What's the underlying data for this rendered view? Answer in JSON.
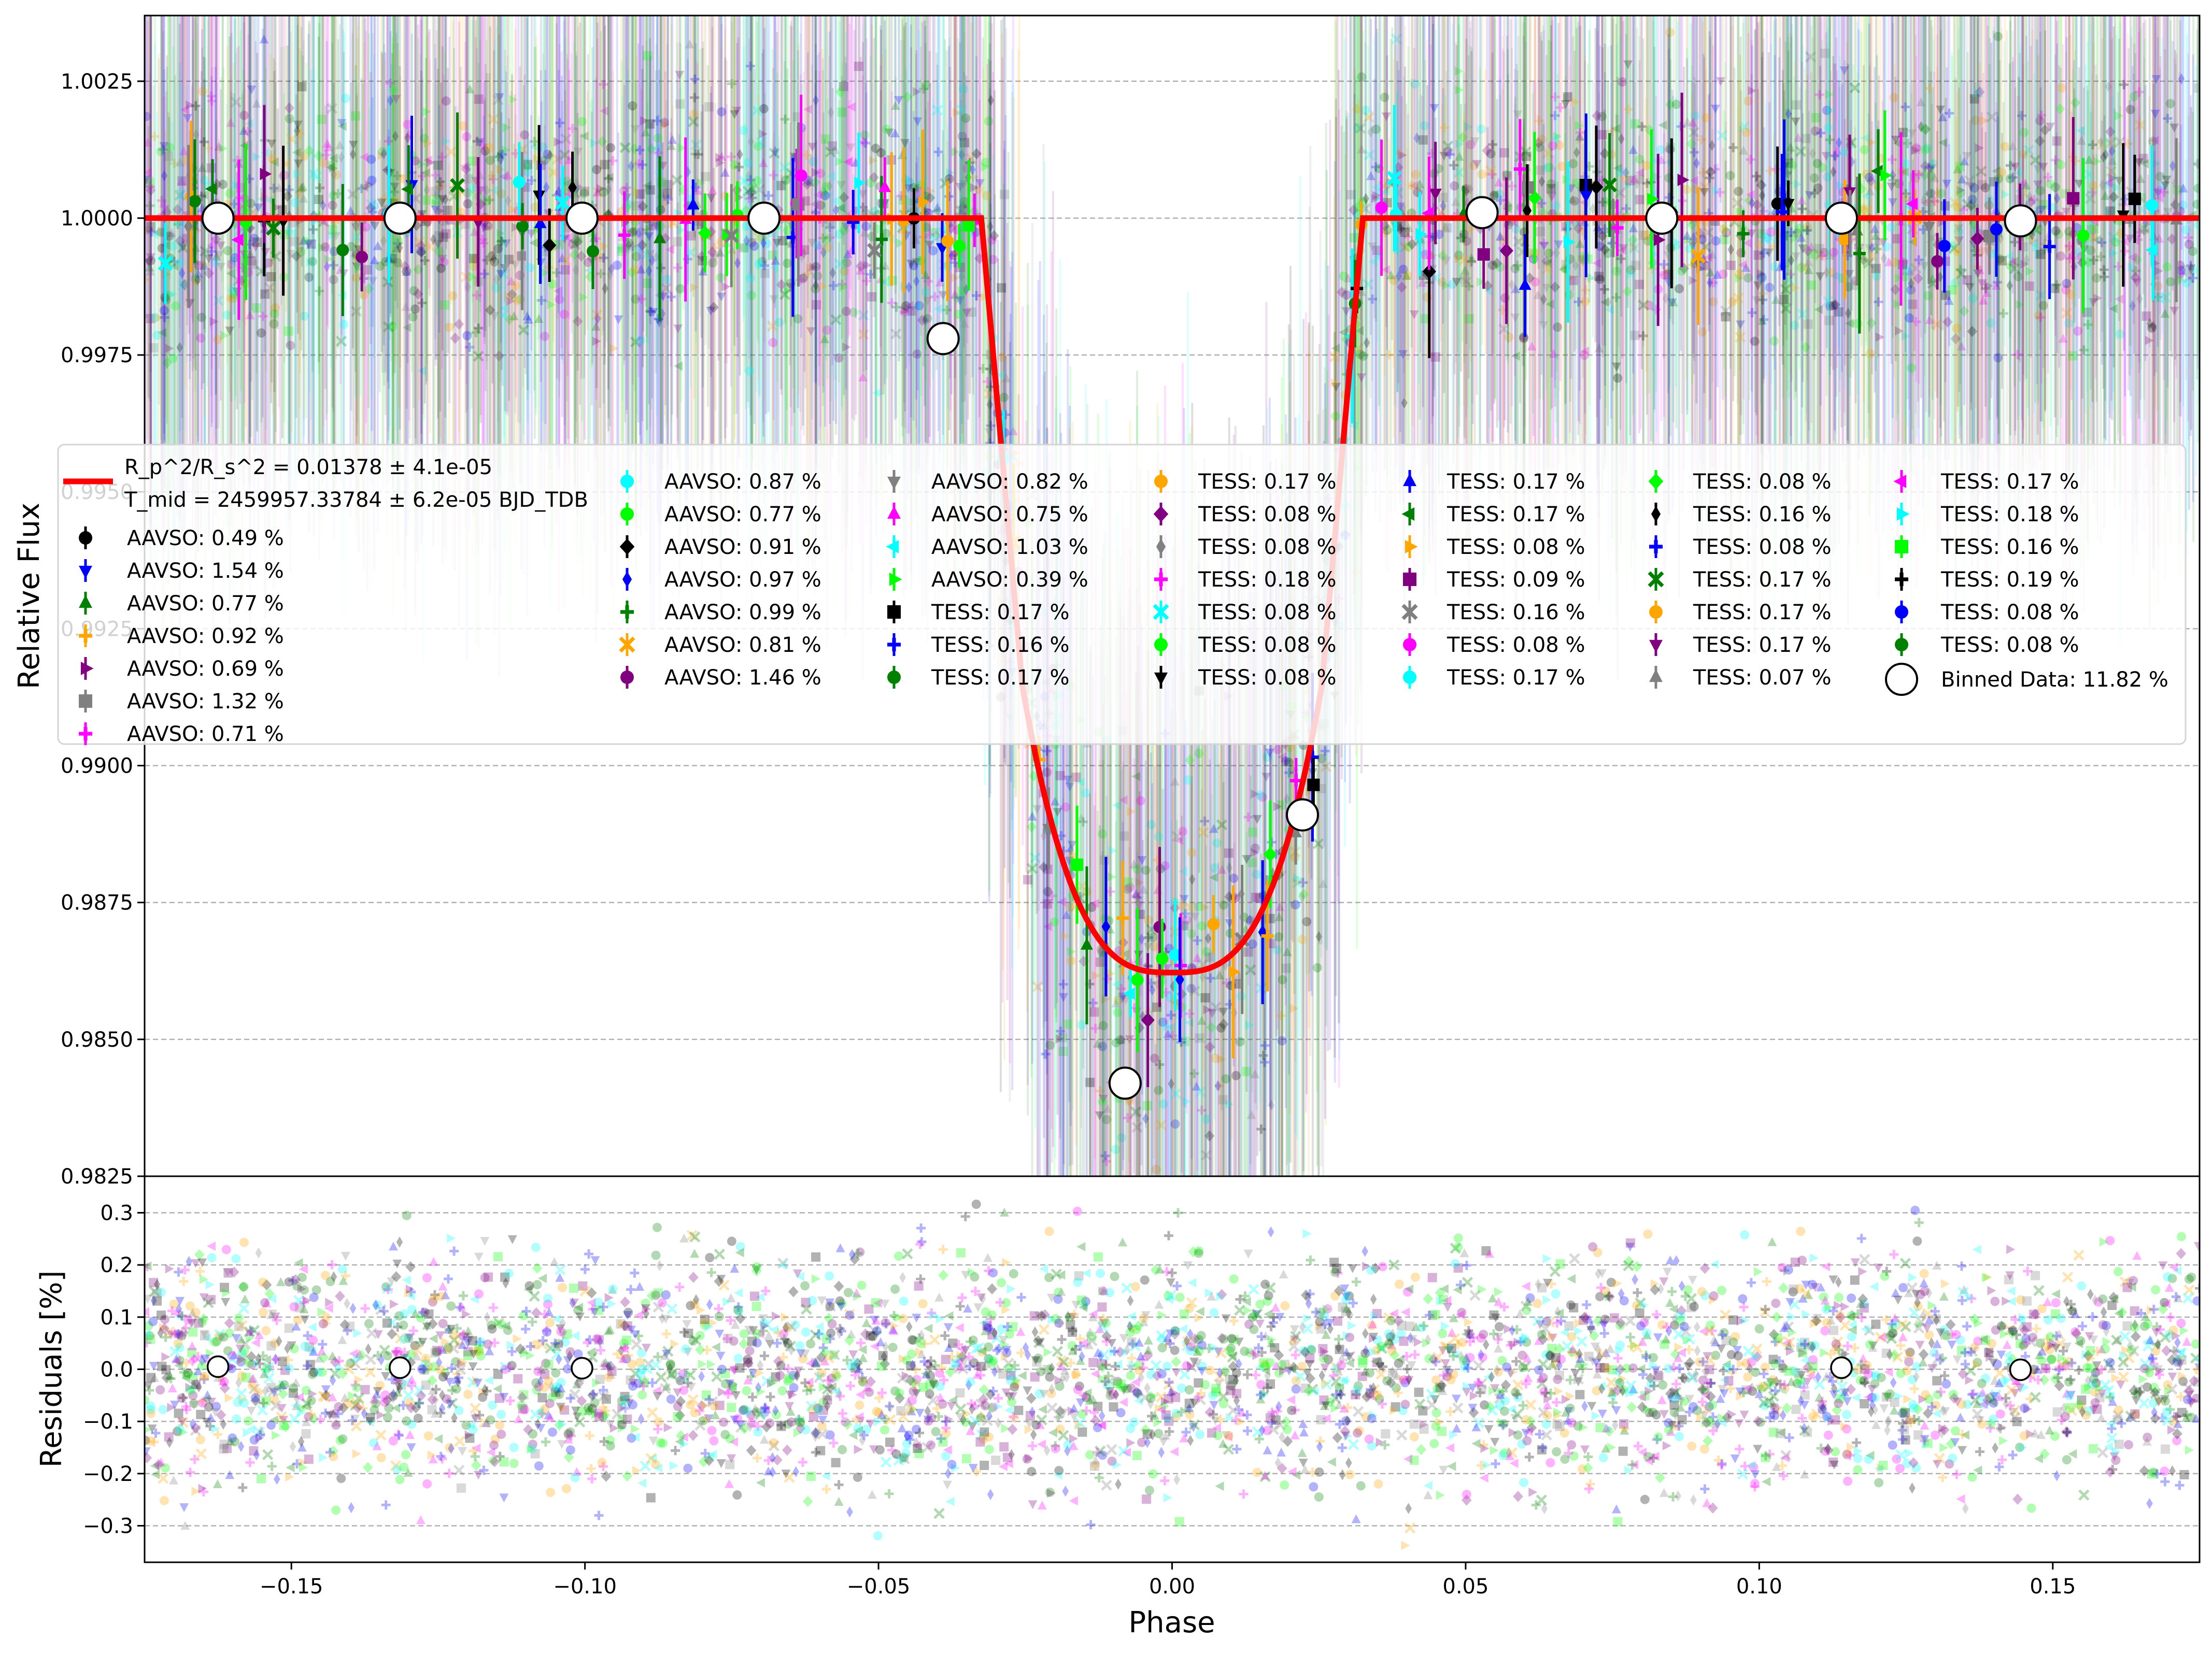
{
  "chart_data": [
    {
      "panel": "top",
      "type": "scatter",
      "xlabel": "Phase",
      "ylabel": "Relative Flux",
      "xlim": [
        -0.175,
        0.175
      ],
      "ylim": [
        0.9825,
        1.0037
      ],
      "yticks": [
        "0.9825",
        "0.9850",
        "0.9875",
        "0.9900",
        "0.9925",
        "0.9950",
        "0.9975",
        "1.0000",
        "1.0025"
      ],
      "grid": "y dashed",
      "legend_position": "center, overlapping upper portion",
      "model": {
        "name_line1": "R_p^2/R_s^2 = 0.01378 ± 4.1e-05",
        "name_line2": "T_mid = 2459957.33784 ± 6.2e-05 BJD_TDB",
        "color": "#ff0000",
        "depth": 0.01378,
        "t1": 0.0325,
        "t2": 0.0255
      },
      "binned": {
        "name": "Binned Data: 11.82 %",
        "x": [
          -0.1625,
          -0.1315,
          -0.1005,
          -0.0695,
          -0.039,
          -0.008,
          0.0222,
          0.0528,
          0.0834,
          0.114,
          0.1445
        ],
        "y": [
          1.0,
          1.0,
          1.0,
          1.0,
          0.9978,
          0.9842,
          0.9891,
          1.0001,
          1.0,
          1.0,
          0.99995
        ]
      },
      "legend": [
        {
          "label": "AAVSO: 0.49 %",
          "color": "#000000",
          "marker": "circle"
        },
        {
          "label": "AAVSO: 1.54 %",
          "color": "#0000ff",
          "marker": "triangle-down"
        },
        {
          "label": "AAVSO: 0.77 %",
          "color": "#008000",
          "marker": "triangle-up"
        },
        {
          "label": "AAVSO: 0.92 %",
          "color": "#ffa500",
          "marker": "tri"
        },
        {
          "label": "AAVSO: 0.69 %",
          "color": "#800080",
          "marker": "triangle-right"
        },
        {
          "label": "AAVSO: 1.32 %",
          "color": "#808080",
          "marker": "square"
        },
        {
          "label": "AAVSO: 0.71 %",
          "color": "#ff00ff",
          "marker": "plus"
        },
        {
          "label": "AAVSO: 0.87 %",
          "color": "#00ffff",
          "marker": "hexagon"
        },
        {
          "label": "AAVSO: 0.77 %",
          "color": "#00ff00",
          "marker": "hexagon"
        },
        {
          "label": "AAVSO: 0.91 %",
          "color": "#000000",
          "marker": "diamond"
        },
        {
          "label": "AAVSO: 0.97 %",
          "color": "#0000ff",
          "marker": "thin-diamond"
        },
        {
          "label": "AAVSO: 0.99 %",
          "color": "#008000",
          "marker": "plus-filled"
        },
        {
          "label": "AAVSO: 0.81 %",
          "color": "#ffa500",
          "marker": "x-filled"
        },
        {
          "label": "AAVSO: 1.46 %",
          "color": "#800080",
          "marker": "circle"
        },
        {
          "label": "AAVSO: 0.82 %",
          "color": "#808080",
          "marker": "triangle-down"
        },
        {
          "label": "AAVSO: 0.75 %",
          "color": "#ff00ff",
          "marker": "triangle-up"
        },
        {
          "label": "AAVSO: 1.03 %",
          "color": "#00ffff",
          "marker": "triangle-left"
        },
        {
          "label": "AAVSO: 0.39 %",
          "color": "#00ff00",
          "marker": "triangle-right"
        },
        {
          "label": "TESS: 0.17 %",
          "color": "#000000",
          "marker": "square"
        },
        {
          "label": "TESS: 0.16 %",
          "color": "#0000ff",
          "marker": "plus"
        },
        {
          "label": "TESS: 0.17 %",
          "color": "#008000",
          "marker": "hexagon"
        },
        {
          "label": "TESS: 0.17 %",
          "color": "#ffa500",
          "marker": "hexagon"
        },
        {
          "label": "TESS: 0.08 %",
          "color": "#800080",
          "marker": "diamond"
        },
        {
          "label": "TESS: 0.08 %",
          "color": "#808080",
          "marker": "thin-diamond"
        },
        {
          "label": "TESS: 0.18 %",
          "color": "#ff00ff",
          "marker": "plus-filled"
        },
        {
          "label": "TESS: 0.08 %",
          "color": "#00ffff",
          "marker": "x-filled"
        },
        {
          "label": "TESS: 0.08 %",
          "color": "#00ff00",
          "marker": "circle"
        },
        {
          "label": "TESS: 0.08 %",
          "color": "#000000",
          "marker": "triangle-down"
        },
        {
          "label": "TESS: 0.17 %",
          "color": "#0000ff",
          "marker": "triangle-up"
        },
        {
          "label": "TESS: 0.17 %",
          "color": "#008000",
          "marker": "triangle-left"
        },
        {
          "label": "TESS: 0.08 %",
          "color": "#ffa500",
          "marker": "triangle-right"
        },
        {
          "label": "TESS: 0.09 %",
          "color": "#800080",
          "marker": "square"
        },
        {
          "label": "TESS: 0.16 %",
          "color": "#808080",
          "marker": "star"
        },
        {
          "label": "TESS: 0.08 %",
          "color": "#ff00ff",
          "marker": "hexagon"
        },
        {
          "label": "TESS: 0.17 %",
          "color": "#00ffff",
          "marker": "hexagon"
        },
        {
          "label": "TESS: 0.08 %",
          "color": "#00ff00",
          "marker": "diamond"
        },
        {
          "label": "TESS: 0.16 %",
          "color": "#000000",
          "marker": "thin-diamond"
        },
        {
          "label": "TESS: 0.08 %",
          "color": "#0000ff",
          "marker": "plus-filled"
        },
        {
          "label": "TESS: 0.17 %",
          "color": "#008000",
          "marker": "x-filled"
        },
        {
          "label": "TESS: 0.17 %",
          "color": "#ffa500",
          "marker": "circle"
        },
        {
          "label": "TESS: 0.17 %",
          "color": "#800080",
          "marker": "triangle-down"
        },
        {
          "label": "TESS: 0.07 %",
          "color": "#808080",
          "marker": "triangle-up"
        },
        {
          "label": "TESS: 0.17 %",
          "color": "#ff00ff",
          "marker": "triangle-left"
        },
        {
          "label": "TESS: 0.18 %",
          "color": "#00ffff",
          "marker": "triangle-right"
        },
        {
          "label": "TESS: 0.16 %",
          "color": "#00ff00",
          "marker": "square"
        },
        {
          "label": "TESS: 0.19 %",
          "color": "#000000",
          "marker": "plus"
        },
        {
          "label": "TESS: 0.08 %",
          "color": "#0000ff",
          "marker": "hexagon"
        },
        {
          "label": "TESS: 0.08 %",
          "color": "#008000",
          "marker": "hexagon"
        }
      ]
    },
    {
      "panel": "bottom",
      "type": "scatter",
      "xlabel": "Phase",
      "ylabel": "Residuals [%]",
      "xlim": [
        -0.175,
        0.175
      ],
      "ylim": [
        -0.37,
        0.37
      ],
      "xticks": [
        "−0.15",
        "−0.10",
        "−0.05",
        "0.00",
        "0.05",
        "0.10",
        "0.15"
      ],
      "yticks": [
        "−0.3",
        "−0.2",
        "−0.1",
        "0.0",
        "0.1",
        "0.2",
        "0.3"
      ],
      "grid": "y dashed",
      "binned_residuals": {
        "x": [
          -0.1625,
          -0.1315,
          -0.1005,
          0.114,
          0.1445
        ],
        "y": [
          0.005,
          0.003,
          0.002,
          0.003,
          -0.001
        ]
      }
    }
  ]
}
